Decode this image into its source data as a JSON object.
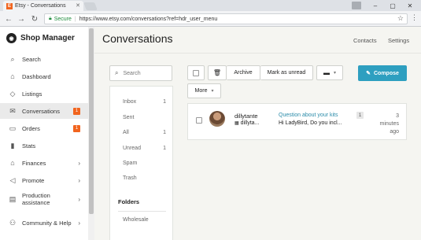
{
  "browser": {
    "tab_title": "Etsy - Conversations",
    "tab_favicon": "E",
    "url_secure_label": "Secure",
    "url": "https://www.etsy.com/conversations?ref=hdr_user_menu"
  },
  "brand": {
    "title": "Shop Manager",
    "icon": "etsy-icon"
  },
  "sidebar": {
    "items": [
      {
        "label": "Search",
        "icon": "search-icon"
      },
      {
        "label": "Dashboard",
        "icon": "home-icon"
      },
      {
        "label": "Listings",
        "icon": "tag-icon"
      },
      {
        "label": "Conversations",
        "icon": "envelope-icon",
        "badge": "1"
      },
      {
        "label": "Orders",
        "icon": "inbox-icon",
        "badge": "1"
      },
      {
        "label": "Stats",
        "icon": "bar-chart-icon"
      },
      {
        "label": "Finances",
        "icon": "bank-icon"
      },
      {
        "label": "Promote",
        "icon": "megaphone-icon"
      },
      {
        "label": "Production assistance",
        "icon": "factory-icon"
      },
      {
        "label": "Community & Help",
        "icon": "community-icon"
      }
    ]
  },
  "header": {
    "title": "Conversations",
    "links": [
      "Contacts",
      "Settings"
    ]
  },
  "search": {
    "placeholder": "Search"
  },
  "folders": {
    "items": [
      {
        "label": "Inbox",
        "count": "1"
      },
      {
        "label": "Sent",
        "count": ""
      },
      {
        "label": "All",
        "count": "1"
      },
      {
        "label": "Unread",
        "count": "1"
      },
      {
        "label": "Spam",
        "count": ""
      },
      {
        "label": "Trash",
        "count": ""
      }
    ],
    "heading": "Folders",
    "custom": [
      "Wholesale"
    ]
  },
  "toolbar": {
    "archive": "Archive",
    "mark_unread": "Mark as unread",
    "more": "More",
    "compose": "Compose"
  },
  "messages": [
    {
      "sender": "dillytante",
      "shop": "dillyta...",
      "subject": "Question about your kits",
      "preview": "Hi LadyBird, Do you incl...",
      "count": "1",
      "time": "3 minutes ago"
    }
  ]
}
